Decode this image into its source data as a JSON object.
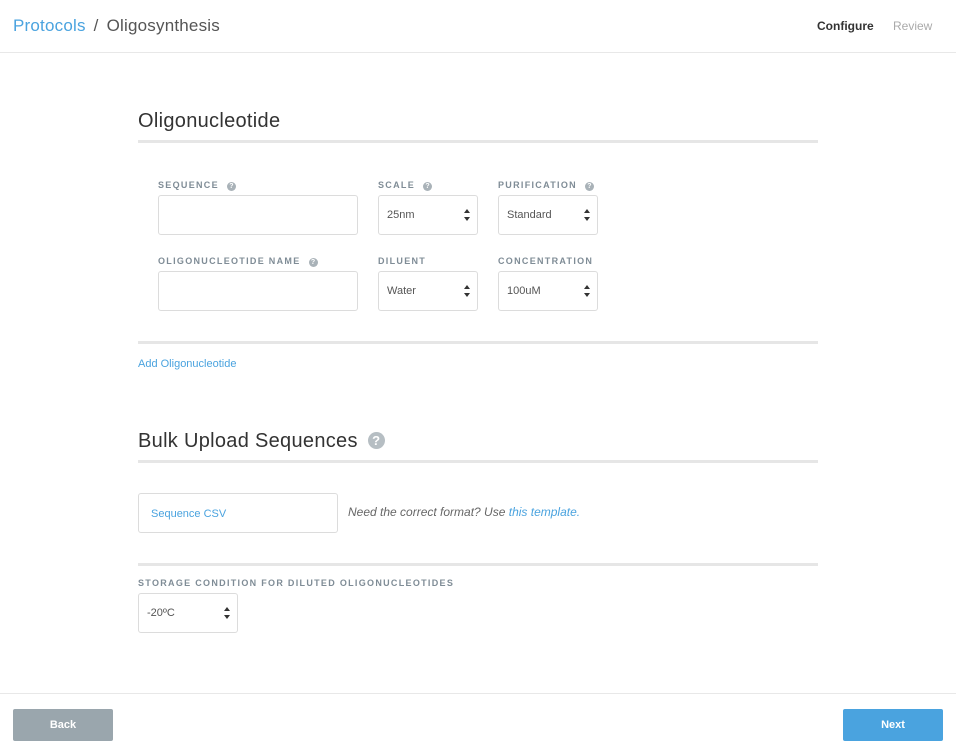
{
  "breadcrumb": {
    "root": "Protocols",
    "separator": "/",
    "current": "Oligosynthesis"
  },
  "steps": {
    "configure": "Configure",
    "review": "Review"
  },
  "oligo_section": {
    "title": "Oligonucleotide",
    "fields": {
      "sequence": {
        "label": "SEQUENCE",
        "value": ""
      },
      "scale": {
        "label": "SCALE",
        "value": "25nm"
      },
      "purification": {
        "label": "PURIFICATION",
        "value": "Standard"
      },
      "name": {
        "label": "OLIGONUCLEOTIDE NAME",
        "value": ""
      },
      "diluent": {
        "label": "DILUENT",
        "value": "Water"
      },
      "concentration": {
        "label": "CONCENTRATION",
        "value": "100uM"
      }
    },
    "add_link": "Add Oligonucleotide"
  },
  "bulk_section": {
    "title": "Bulk Upload Sequences",
    "help_glyph": "?",
    "csv_button": "Sequence CSV",
    "note_prefix": "Need the correct format? Use ",
    "note_link": "this template."
  },
  "storage": {
    "label": "STORAGE CONDITION FOR DILUTED OLIGONUCLEOTIDES",
    "value": "-20ºC"
  },
  "footer": {
    "back": "Back",
    "next": "Next"
  },
  "icons": {
    "help": "question-circle-icon",
    "select_arrows": "sort-arrows-icon"
  },
  "colors": {
    "accent": "#4aa3df",
    "back_button": "#9aa6ad",
    "label": "#7f8c96"
  }
}
